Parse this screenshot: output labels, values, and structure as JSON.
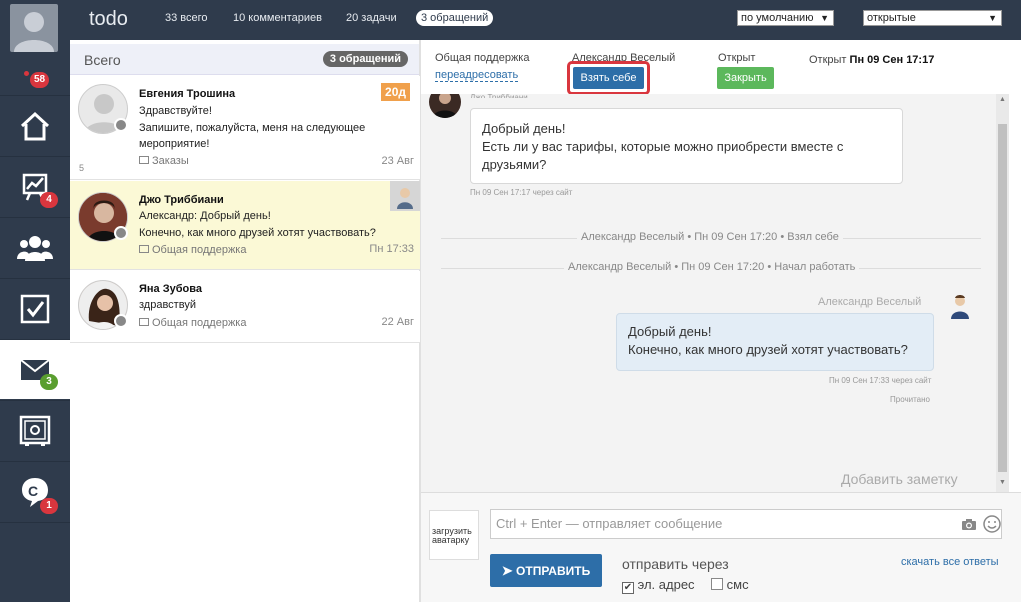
{
  "sidebar": {
    "badges": {
      "avatar": "58",
      "stats": "4",
      "mail": "3",
      "chat": "1"
    }
  },
  "topbar": {
    "title": "todo",
    "links": [
      "33 всего",
      "10 комментариев",
      "20 задачи",
      "3 обращений"
    ],
    "sort_select": "по умолчанию",
    "filter_select": "открытые"
  },
  "list": {
    "header": "Всего",
    "header_pill": "3 обращений",
    "items": [
      {
        "name": "Евгения Трошина",
        "lines": [
          "Здравствуйте!",
          "Запишите, пожалуйста, меня на следующее",
          "мероприятие!"
        ],
        "tag": "Заказы",
        "date": "23 Авг",
        "age": "20д",
        "count": "5"
      },
      {
        "name": "Джо Триббиани",
        "lines": [
          "Александр: Добрый день!",
          "Конечно, как много друзей хотят участвовать?"
        ],
        "tag": "Общая поддержка",
        "date": "Пн 17:33"
      },
      {
        "name": "Яна Зубова",
        "lines": [
          "здравствуй"
        ],
        "tag": "Общая поддержка",
        "date": "22 Авг"
      }
    ]
  },
  "chat": {
    "department": "Общая поддержка",
    "redirect": "переадресовать",
    "agent": "Александр Веселый",
    "take": "Взять себе",
    "status": "Открыт",
    "close": "Закрыть",
    "opened_label": "Открыт",
    "opened_date": "Пн 09 Сен 17:17",
    "partial_sender": "Джо Триббиани",
    "msg1_lines": [
      "Добрый день!",
      "Есть ли у вас тарифы, которые можно приобрести вместе с",
      "друзьями?"
    ],
    "msg1_meta": "Пн 09 Сен 17:17 через сайт",
    "sys1": "Александр Веселый • Пн 09 Сен 17:20 • Взял себе",
    "sys2": "Александр Веселый • Пн 09 Сен 17:20 • Начал работать",
    "msg2_sender": "Александр Веселый",
    "msg2_lines": [
      "Добрый день!",
      "Конечно, как много друзей хотят участвовать?"
    ],
    "msg2_meta": "Пн 09 Сен 17:33 через сайт",
    "msg2_read": "Прочитано",
    "add_note": "Добавить заметку"
  },
  "composer": {
    "upload_avatar": "загрузить аватарку",
    "placeholder": "Ctrl + Enter — отправляет сообщение",
    "send": "ОТПРАВИТЬ",
    "send_via": "отправить через",
    "email": "эл. адрес",
    "sms": "смс",
    "download": "скачать все ответы"
  },
  "colors": {
    "sidebar": "#2f3b4c",
    "accent_blue": "#2d6ea8",
    "green": "#5cb85c",
    "highlight": "#fbf9d6",
    "badge_red": "#d9363e"
  }
}
